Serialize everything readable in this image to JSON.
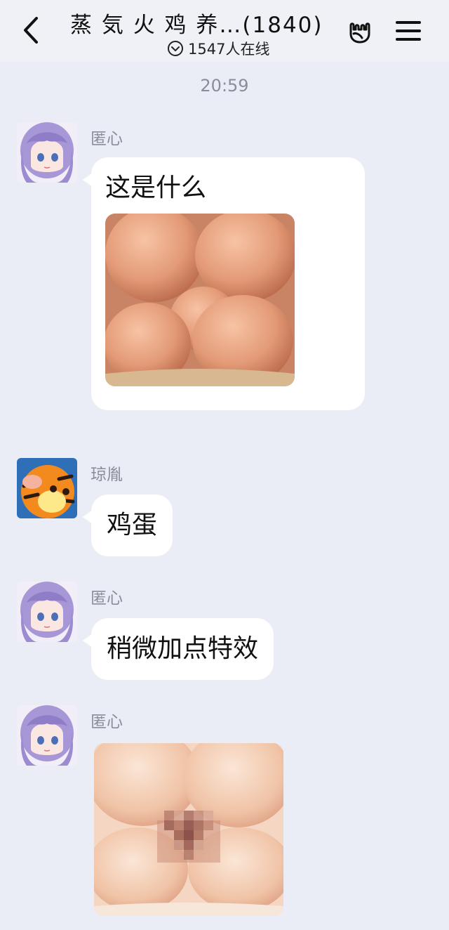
{
  "header": {
    "title": "蒸 気 火 鸡 养…(1840)",
    "online_text": "1547人在线",
    "back_icon": "chevron-left-icon",
    "gesture_icon": "rock-hand-icon",
    "menu_icon": "hamburger-menu-icon"
  },
  "timestamp": "20:59",
  "messages": [
    {
      "sender": "匿心",
      "text": "这是什么",
      "image": "eggs-photo"
    },
    {
      "sender": "琼胤",
      "text": "鸡蛋"
    },
    {
      "sender": "匿心",
      "text": "稍微加点特效"
    },
    {
      "sender": "匿心",
      "image": "eggs-censored-photo"
    }
  ],
  "colors": {
    "background": "#eaedf5",
    "header_bg": "#eff1f7",
    "bubble": "#ffffff",
    "meta_text": "#8a8e99"
  }
}
